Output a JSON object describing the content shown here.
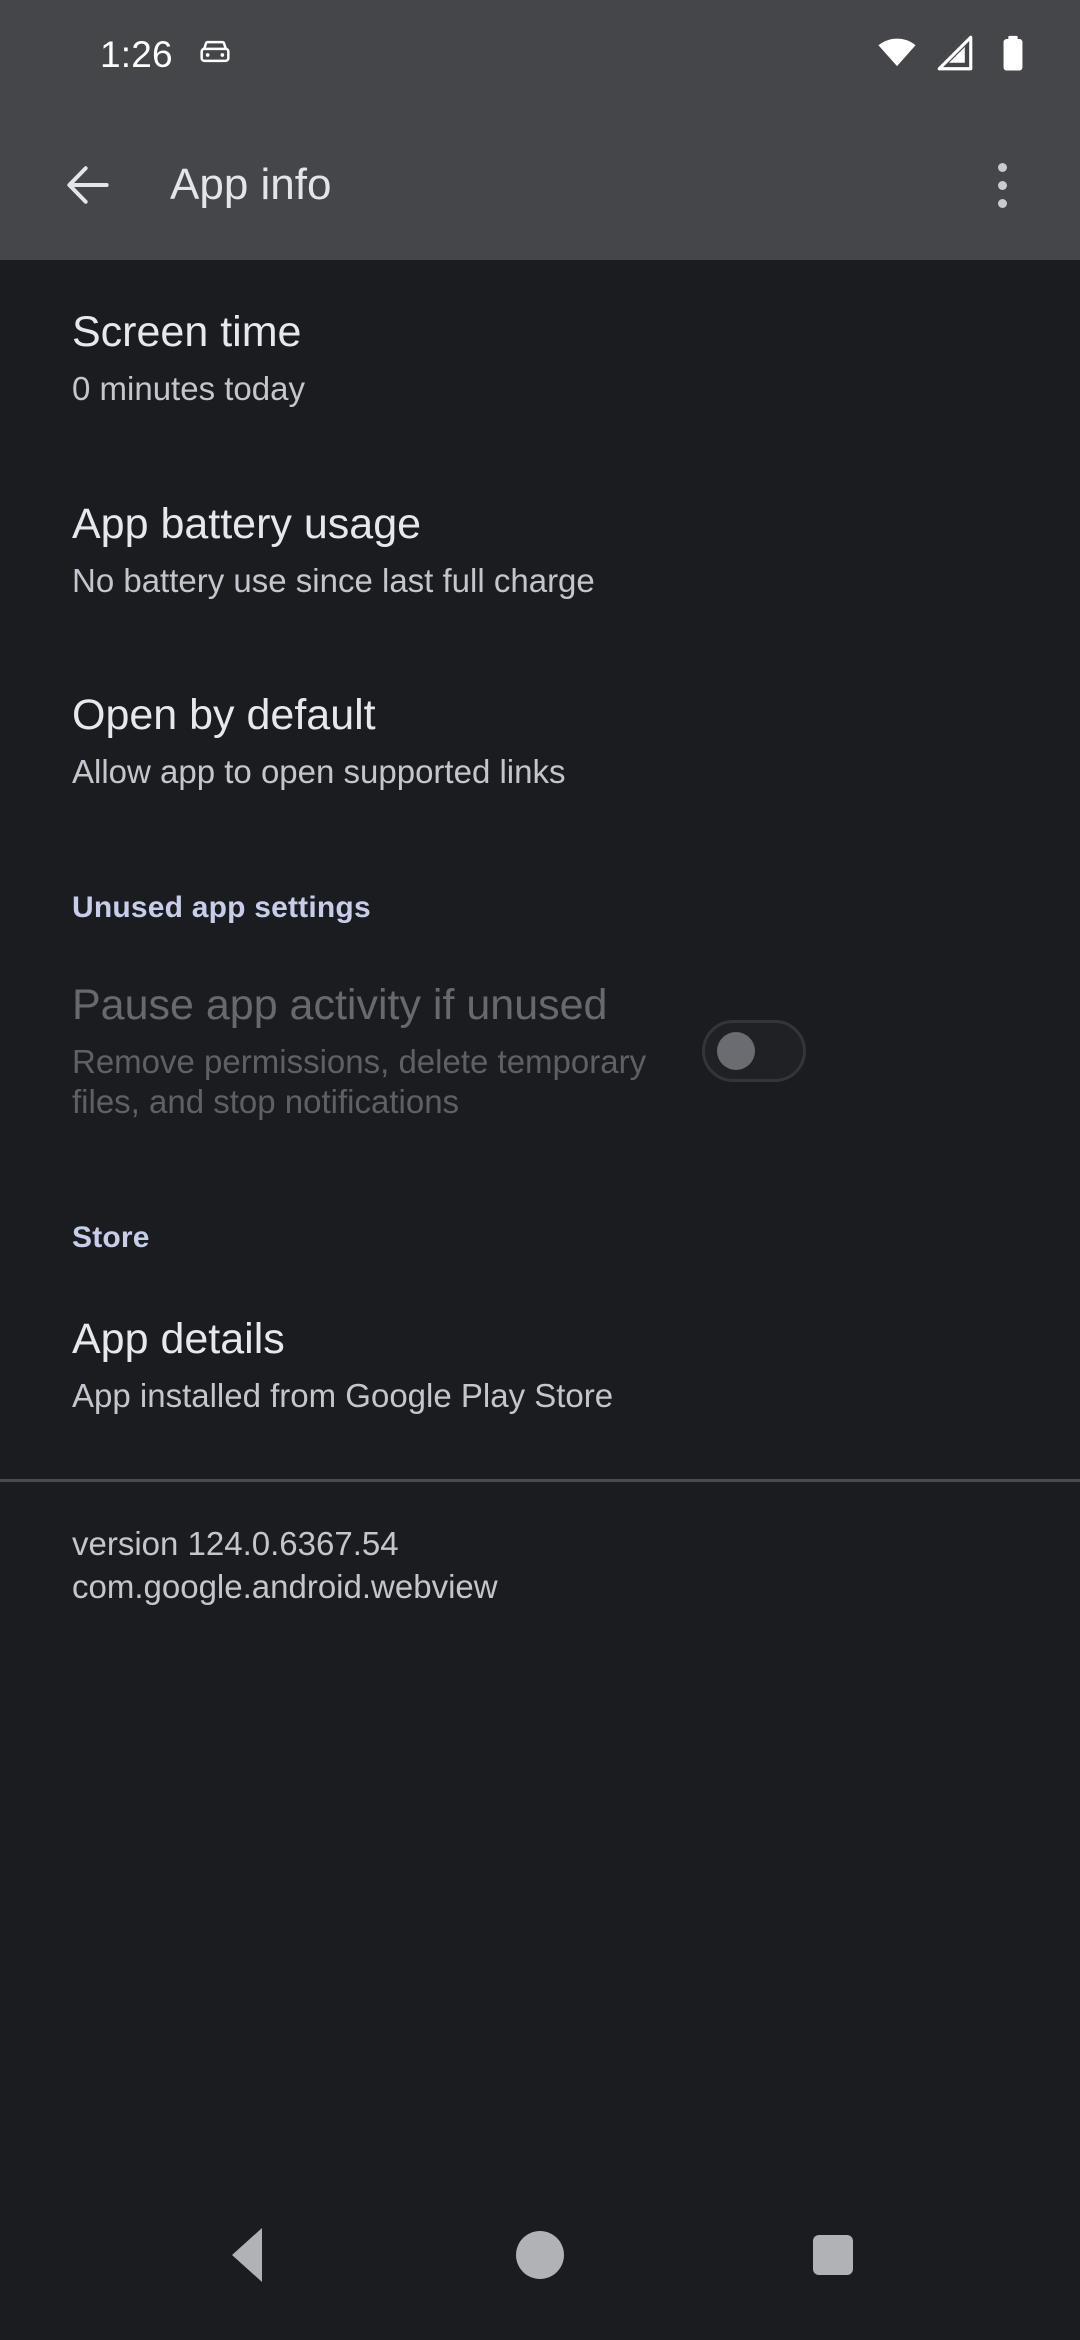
{
  "status_bar": {
    "time": "1:26",
    "icons": [
      "car-icon",
      "wifi-icon",
      "signal-icon",
      "battery-icon"
    ]
  },
  "app_bar": {
    "back_icon": "back-arrow-icon",
    "title": "App info",
    "overflow_icon": "overflow-menu-icon"
  },
  "preferences": [
    {
      "title": "Screen time",
      "summary": "0 minutes today"
    },
    {
      "title": "App battery usage",
      "summary": "No battery use since last full charge"
    },
    {
      "title": "Open by default",
      "summary": "Allow app to open supported links"
    }
  ],
  "unused_section": {
    "header": "Unused app settings",
    "pause": {
      "title": "Pause app activity if unused",
      "summary": "Remove permissions, delete temporary files, and stop notifications",
      "enabled": false,
      "checked": false
    }
  },
  "store_section": {
    "header": "Store",
    "app_details": {
      "title": "App details",
      "summary": "App installed from Google Play Store"
    }
  },
  "footer": {
    "version": "version 124.0.6367.54",
    "package": "com.google.android.webview"
  },
  "nav_bar": {
    "back": "nav-back-icon",
    "home": "nav-home-icon",
    "recents": "nav-recents-icon"
  },
  "colors": {
    "app_bar_bg": "#45464a",
    "content_bg": "#1b1c20",
    "title_text": "#e7e8ec",
    "summary_text": "#c3c6cd",
    "section_accent": "#c8cdea",
    "disabled_text": "#68696e"
  }
}
